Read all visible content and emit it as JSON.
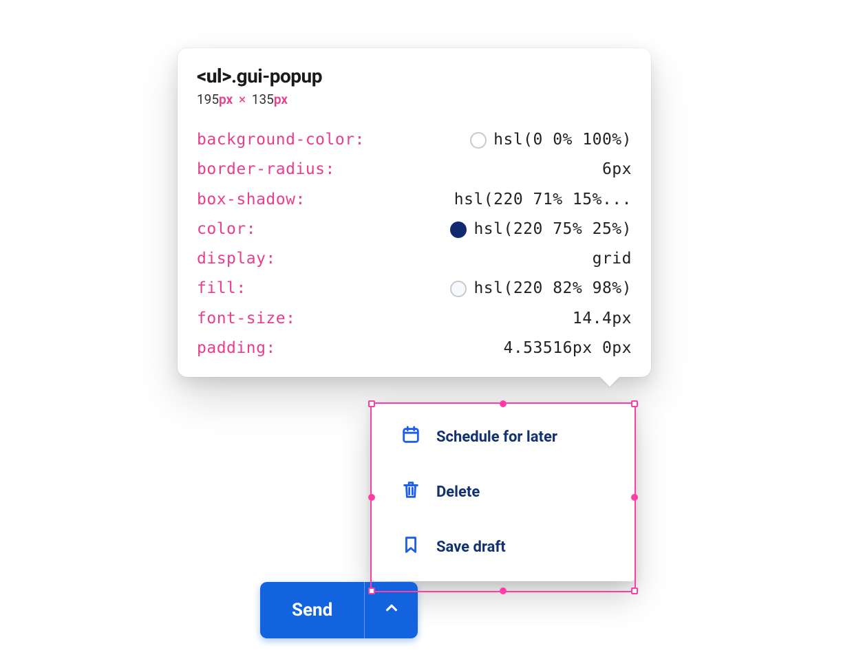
{
  "tooltip": {
    "selector_tag": "<ul>",
    "selector_class": ".gui-popup",
    "dims": {
      "w": "195",
      "w_unit": "px",
      "sep": "×",
      "h": "135",
      "h_unit": "px"
    },
    "rows": [
      {
        "prop": "background-color:",
        "value": "hsl(0 0% 100%)",
        "swatch": "#ffffff",
        "swatch_filled": false
      },
      {
        "prop": "border-radius:",
        "value": "6px"
      },
      {
        "prop": "box-shadow:",
        "value": "hsl(220 71% 15%..."
      },
      {
        "prop": "color:",
        "value": "hsl(220 75% 25%)",
        "swatch": "#10296f",
        "swatch_filled": true
      },
      {
        "prop": "display:",
        "value": "grid"
      },
      {
        "prop": "fill:",
        "value": "hsl(220 82% 98%)",
        "swatch": "#f6f9fe",
        "swatch_filled": false
      },
      {
        "prop": "font-size:",
        "value": "14.4px"
      },
      {
        "prop": "padding:",
        "value": "4.53516px 0px"
      }
    ]
  },
  "popup": {
    "items": [
      {
        "icon": "calendar-icon",
        "label": "Schedule for later"
      },
      {
        "icon": "trash-icon",
        "label": "Delete"
      },
      {
        "icon": "bookmark-icon",
        "label": "Save draft"
      }
    ]
  },
  "send_button": {
    "label": "Send"
  }
}
